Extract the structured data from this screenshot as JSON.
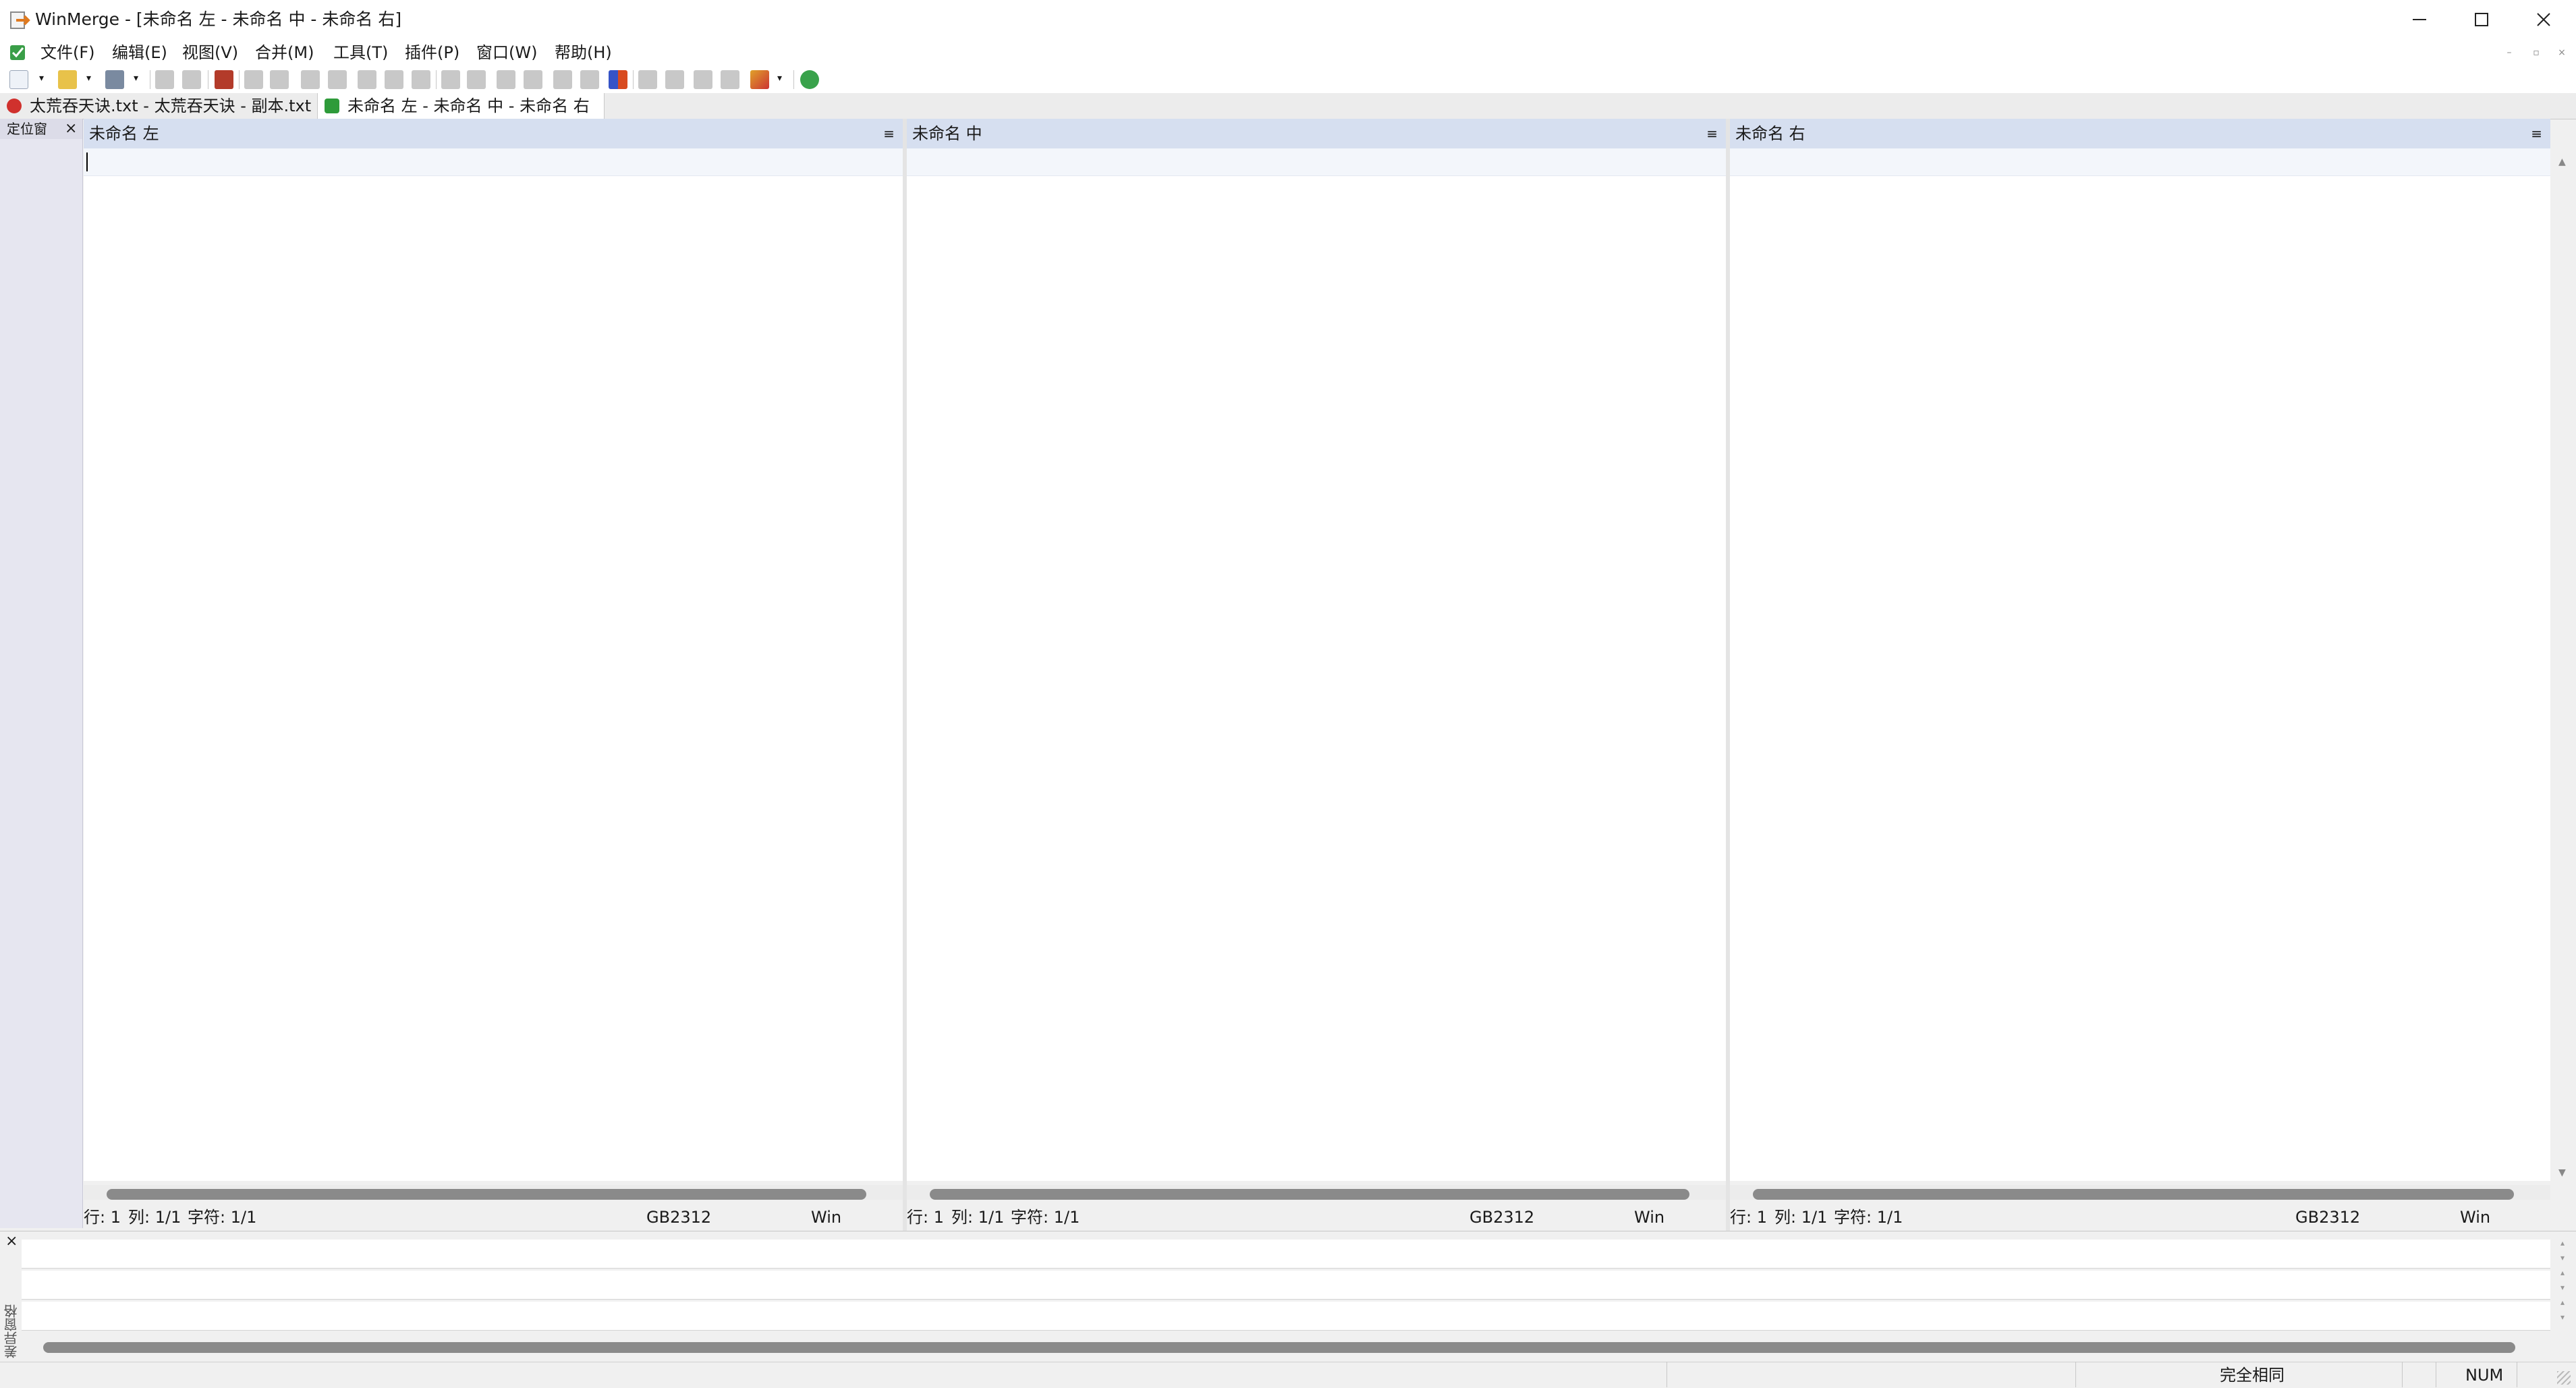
{
  "window": {
    "title": "WinMerge - [未命名 左 - 未命名 中 - 未命名 右]"
  },
  "menu": {
    "items": [
      "文件(F)",
      "编辑(E)",
      "视图(V)",
      "合并(M)",
      "工具(T)",
      "插件(P)",
      "窗口(W)",
      "帮助(H)"
    ]
  },
  "tabs": [
    {
      "label": "太荒吞天诀.txt - 太荒吞天诀 - 副本.txt",
      "status_icon": "error-icon"
    },
    {
      "label": "未命名 左 - 未命名 中 - 未命名 右",
      "status_icon": "check-icon"
    }
  ],
  "location_pane": {
    "title": "定位窗"
  },
  "panes": [
    {
      "header": "未命名 左",
      "line": "行: 1",
      "col": "列: 1/1",
      "char": "字符: 1/1",
      "encoding": "GB2312",
      "eol": "Win"
    },
    {
      "header": "未命名 中",
      "line": "行: 1",
      "col": "列: 1/1",
      "char": "字符: 1/1",
      "encoding": "GB2312",
      "eol": "Win"
    },
    {
      "header": "未命名 右",
      "line": "行: 1",
      "col": "列: 1/1",
      "char": "字符: 1/1",
      "encoding": "GB2312",
      "eol": "Win"
    }
  ],
  "diff_pane": {
    "title": "差异窗格"
  },
  "statusbar": {
    "status": "完全相同",
    "numlock": "NUM"
  },
  "colors": {
    "pane_header": "#d6dff0",
    "location_pane": "#e6e6f0",
    "accent_red": "#d0312d",
    "accent_green": "#2e9b3a"
  }
}
